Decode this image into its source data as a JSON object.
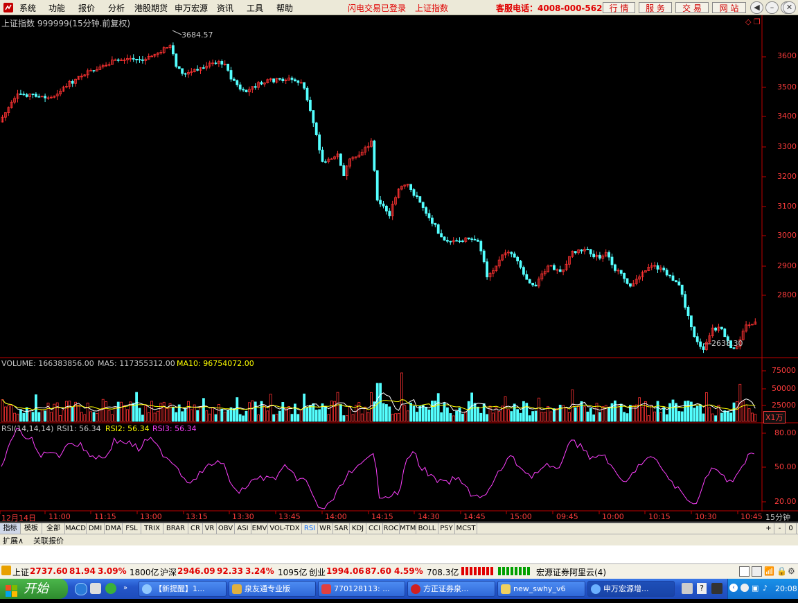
{
  "menu": {
    "items": [
      "系统",
      "功能",
      "报价",
      "分析",
      "港股期货",
      "申万宏源",
      "资讯",
      "工具",
      "帮助"
    ],
    "status_login": "闪电交易已登录",
    "status_index": "上证指数",
    "service_hotline": "客服电话：4008-000-562",
    "tool_buttons": [
      "行 情",
      "服 务",
      "交 易",
      "网 站"
    ]
  },
  "chart": {
    "main_title": "上证指数 999999(15分钟.前复权)",
    "high_label": "3684.57",
    "low_label": "2638.30",
    "price_axis": [
      "3600",
      "3500",
      "3400",
      "3300",
      "3200",
      "3100",
      "3000",
      "2900",
      "2800"
    ],
    "volume_title": {
      "volume": "VOLUME: 166383856.00",
      "ma5": "MA5: 117355312.00",
      "ma10": "MA10: 96754072.00"
    },
    "volume_axis": [
      "75000",
      "50000",
      "25000"
    ],
    "volume_unit": "X1万",
    "rsi_title": {
      "name": "RSI(14,14,14)",
      "rsi1": "RSI1: 56.34",
      "rsi2": "RSI2: 56.34",
      "rsi3": "RSI3: 56.34"
    },
    "rsi_axis": [
      "80.00",
      "50.00",
      "20.00"
    ],
    "time_axis": [
      "12月14日",
      "11:00",
      "11:15",
      "13:00",
      "13:15",
      "13:30",
      "13:45",
      "14:00",
      "14:15",
      "14:30",
      "14:45",
      "15:00",
      "09:45",
      "10:00",
      "10:15",
      "10:30",
      "10:45"
    ],
    "period": "15分钟",
    "colors": {
      "up": "#ff3232",
      "down": "#54ffff",
      "ma5": "#ffffff",
      "ma10": "#ffff00",
      "rsi": "#ff40ff",
      "axis": "#c00000",
      "axis_text": "#ff3c3c"
    }
  },
  "indicator_tabs": [
    "指标",
    "模板",
    "全部",
    "MACD",
    "DMI",
    "DMA",
    "FSL",
    "TRIX",
    "BRAR",
    "CR",
    "VR",
    "OBV",
    "ASI",
    "EMV",
    "VOL-TDX",
    "RSI",
    "WR",
    "SAR",
    "KDJ",
    "CCI",
    "ROC",
    "MTM",
    "BOLL",
    "PSY",
    "MCST"
  ],
  "indicator_selected": "RSI",
  "zoom_buttons": [
    "+",
    "-",
    "0"
  ],
  "sub_tabs": [
    "扩展∧",
    "关联报价"
  ],
  "statusbar": {
    "sh_label": "上证",
    "sh_value": "2737.60",
    "sh_change": "81.94",
    "sh_pct": "3.09%",
    "sh_amount": "1800亿",
    "hs_label": "沪深",
    "hs_value": "2946.09",
    "hs_change": "92.33",
    "hs_pct": "3.24%",
    "hs_amount": "1095亿",
    "cy_label": "创业",
    "cy_value": "1994.06",
    "cy_change": "87.60",
    "cy_pct": "4.59%",
    "cy_amount": "708.3亿",
    "server": "宏源证券阿里云(4)"
  },
  "taskbar": {
    "start": "开始",
    "tasks": [
      "【新提醒】1...",
      "泉友通专业版",
      "770128113: ...",
      "方正证券泉...",
      "new_swhy_v6",
      "申万宏源增..."
    ],
    "time": "20:08"
  }
}
